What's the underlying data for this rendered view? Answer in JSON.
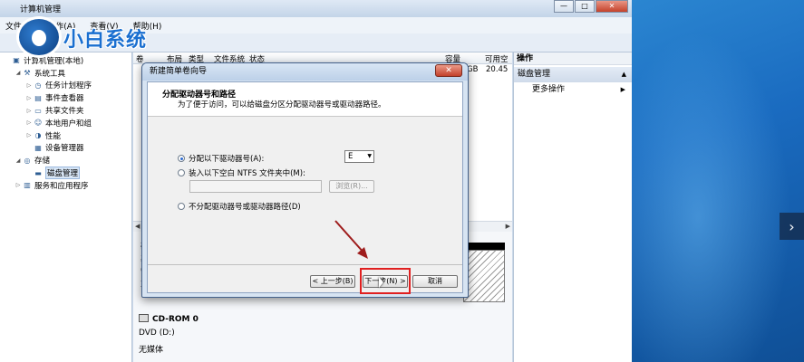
{
  "window": {
    "title": "计算机管理",
    "controls": [
      "—",
      "□",
      "✕"
    ]
  },
  "menu": [
    "文件(F)",
    "操作(A)",
    "查看(V)",
    "帮助(H)"
  ],
  "logo_text": "小白系统",
  "tree": [
    {
      "label": "计算机管理(本地)",
      "indent": 0,
      "exp": "",
      "icon": "computer-icon"
    },
    {
      "label": "系统工具",
      "indent": 1,
      "exp": "◢",
      "icon": "tools-icon"
    },
    {
      "label": "任务计划程序",
      "indent": 2,
      "exp": "▷",
      "icon": "clock-icon"
    },
    {
      "label": "事件查看器",
      "indent": 2,
      "exp": "▷",
      "icon": "event-icon"
    },
    {
      "label": "共享文件夹",
      "indent": 2,
      "exp": "▷",
      "icon": "folder-icon"
    },
    {
      "label": "本地用户和组",
      "indent": 2,
      "exp": "▷",
      "icon": "users-icon"
    },
    {
      "label": "性能",
      "indent": 2,
      "exp": "▷",
      "icon": "performance-icon"
    },
    {
      "label": "设备管理器",
      "indent": 2,
      "exp": "",
      "icon": "device-icon"
    },
    {
      "label": "存储",
      "indent": 1,
      "exp": "◢",
      "icon": "storage-icon"
    },
    {
      "label": "磁盘管理",
      "indent": 2,
      "exp": "",
      "icon": "disk-icon",
      "selected": true
    },
    {
      "label": "服务和应用程序",
      "indent": 1,
      "exp": "▷",
      "icon": "services-icon"
    }
  ],
  "columns": {
    "c0": "卷",
    "c1": "布局",
    "c2": "类型",
    "c3": "文件系统",
    "c4": "状态",
    "c5": "容量",
    "c6": "可用空"
  },
  "list_row": {
    "capacity_frag": "GB",
    "free": "20.45"
  },
  "lower_frags": [
    "磁",
    "基",
    "6",
    "耳"
  ],
  "cdrom": {
    "title": "CD-ROM 0",
    "type": "DVD (D:)",
    "media": "无媒体"
  },
  "actions": {
    "header": "操作",
    "section": "磁盘管理",
    "item": "更多操作"
  },
  "wizard": {
    "title": "新建简单卷向导",
    "close": "✕",
    "heading": "分配驱动器号和路径",
    "subheading": "为了便于访问，可以给磁盘分区分配驱动器号或驱动器路径。",
    "opt_assign": "分配以下驱动器号(A):",
    "drive_letter": "E",
    "opt_mount": "装入以下空白 NTFS 文件夹中(M):",
    "browse": "浏览(R)...",
    "opt_none": "不分配驱动器号或驱动器路径(D)",
    "back": "< 上一步(B)",
    "next": "下一步(N) >",
    "cancel": "取消"
  },
  "desktop_next": "›",
  "colors": {
    "highlight": "#e02020",
    "annotation_arrow": "#9e1c1c",
    "desktop": "#1d6fb8"
  }
}
